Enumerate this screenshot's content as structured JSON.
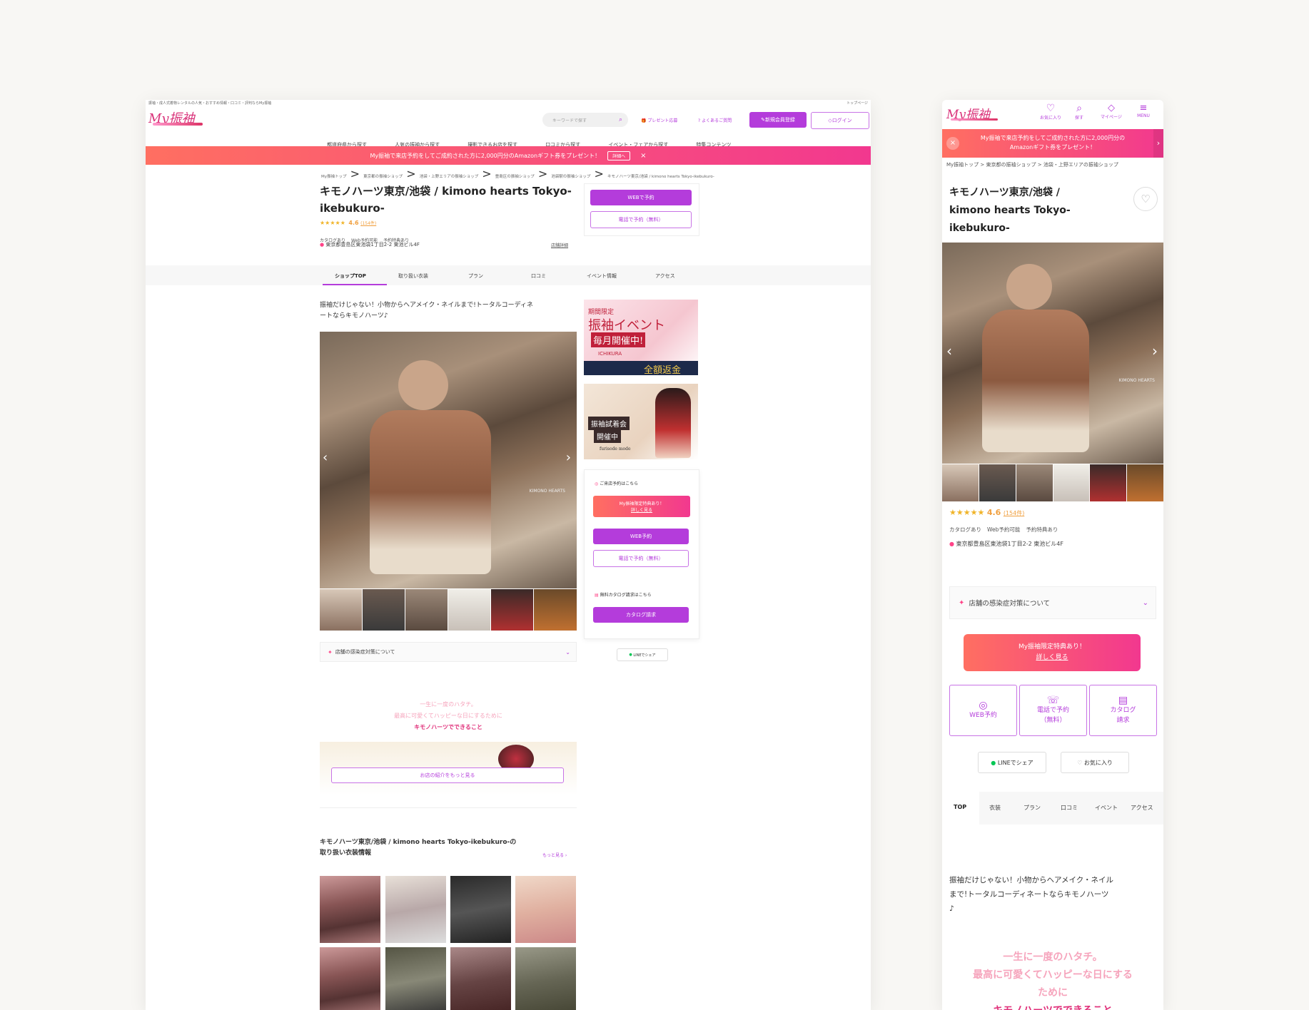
{
  "desktop": {
    "topbar_left": "振袖・成人式着物レンタルの人気・おすすめ情報・口コミ・評判ならMy振袖",
    "topbar_right": "トップページ",
    "logo": "My振袖",
    "search_placeholder": "キーワードで探す",
    "head_links": [
      "プレゼント応募",
      "よくあるご質問"
    ],
    "register_label": "新規会員登録",
    "login_label": "ログイン",
    "gnav": [
      "都道府県から探す",
      "人気の振袖から探す",
      "撮影できるお店を探す",
      "口コミから探す",
      "イベント・フェアから探す",
      "特集コンテンツ"
    ],
    "banner_text": "My振袖で来店予約をしてご成約された方に2,000円分のAmazonギフト券をプレゼント！",
    "banner_btn": "詳細へ",
    "breadcrumbs": [
      "My振袖トップ",
      "東京都の振袖ショップ",
      "池袋・上野エリアの振袖ショップ",
      "豊島区の振袖ショップ",
      "池袋駅の振袖ショップ",
      "キモノハーツ東京/池袋 / kimono hearts Tokyo-ikebukuro-"
    ],
    "shop_title_1": "キモノハーツ東京/池袋 / kimono hearts Tokyo-",
    "shop_title_2": "ikebukuro-",
    "stars": "★★★★★",
    "rating": "4.6",
    "review_count": "(154件)",
    "tags": [
      "カタログあり",
      "Web予約可能",
      "予約特典あり"
    ],
    "address": "東京都豊島区東池袋1丁目2-2 東池ビル4F",
    "shop_detail": "店舗詳細",
    "web_reserve": "WEBで予約",
    "tel_reserve": "電話で予約（無料）",
    "tabs": [
      "ショップTOP",
      "取り扱い衣装",
      "プラン",
      "口コミ",
      "イベント情報",
      "アクセス"
    ],
    "catch_line1": "振袖だけじゃない！小物からヘアメイク・ネイルまで!トータルコーディネ",
    "catch_line2": "ートならキモノハーツ♪",
    "photo_credit": "KIMONO HEARTS",
    "infection": "店舗の感染症対策について",
    "ad1_lines": [
      "期間限定",
      "振袖イベント",
      "毎月開催中!",
      "ICHIKURA",
      "全額返金"
    ],
    "ad2_lines": [
      "振袖試着会",
      "開催中",
      "furisode mode"
    ],
    "side_visit": "ご来店予約はこちら",
    "side_promo1": "My振袖限定特典あり！",
    "side_promo2": "詳しく見る",
    "side_web": "WEB予約",
    "side_tel": "電話で予約（無料）",
    "side_catalog_head": "無料カタログ請求はこちら",
    "side_catalog": "カタログ請求",
    "line_share": "LINEでシェア",
    "feature_1": "一生に一度のハタチ。",
    "feature_2": "最高に可愛くてハッピーな日にするために",
    "feature_3": "キモノハーツでできること",
    "more_intro": "お店の紹介をもっと見る",
    "costume_head_1": "キモノハーツ東京/池袋 / kimono hearts Tokyo-ikebukuro-の",
    "costume_head_2": "取り扱い衣装情報",
    "more_link": "もっと見る"
  },
  "mobile": {
    "logo": "My振袖",
    "icons": [
      "お気に入り",
      "探す",
      "マイページ",
      "MENU"
    ],
    "banner_1": "My振袖で来店予約をしてご成約された方に2,000円分の",
    "banner_2": "Amazonギフト券をプレゼント！",
    "crumbs": [
      "My振袖トップ",
      "東京都の振袖ショップ",
      "池袋・上野エリアの振袖ショップ"
    ],
    "title_1": "キモノハーツ東京/池袋 /",
    "title_2": "kimono hearts Tokyo-",
    "title_3": "ikebukuro-",
    "photo_credit": "KIMONO HEARTS",
    "stars": "★★★★★",
    "rating": "4.6",
    "review_count": "(154件)",
    "tags": [
      "カタログあり",
      "Web予約可能",
      "予約特典あり"
    ],
    "address": "東京都豊島区東池袋1丁目2-2 東池ビル4F",
    "infection": "店舗の感染症対策について",
    "promo_1": "My振袖限定特典あり！",
    "promo_2": "詳しく見る",
    "btn_web": "WEB予約",
    "btn_tel_1": "電話で予約",
    "btn_tel_2": "（無料）",
    "btn_cat_1": "カタログ",
    "btn_cat_2": "請求",
    "line_share": "LINEでシェア",
    "fav": "お気に入り",
    "tabs": [
      "TOP",
      "衣装",
      "プラン",
      "口コミ",
      "イベント",
      "アクセス"
    ],
    "catch_1": "振袖だけじゃない！小物からヘアメイク・ネイル",
    "catch_2": "まで!トータルコーディネートならキモノハーツ",
    "catch_3": "♪",
    "feat_1": "一生に一度のハタチ。",
    "feat_2": "最高に可愛くてハッピーな日にする",
    "feat_3": "ために",
    "feat_4": "キモノハーツでできること"
  },
  "colors": {
    "accent": "#b43cdb",
    "pink": "#f24b8c",
    "banner_grad_start": "#ff6f61",
    "banner_grad_end": "#f2388f"
  }
}
